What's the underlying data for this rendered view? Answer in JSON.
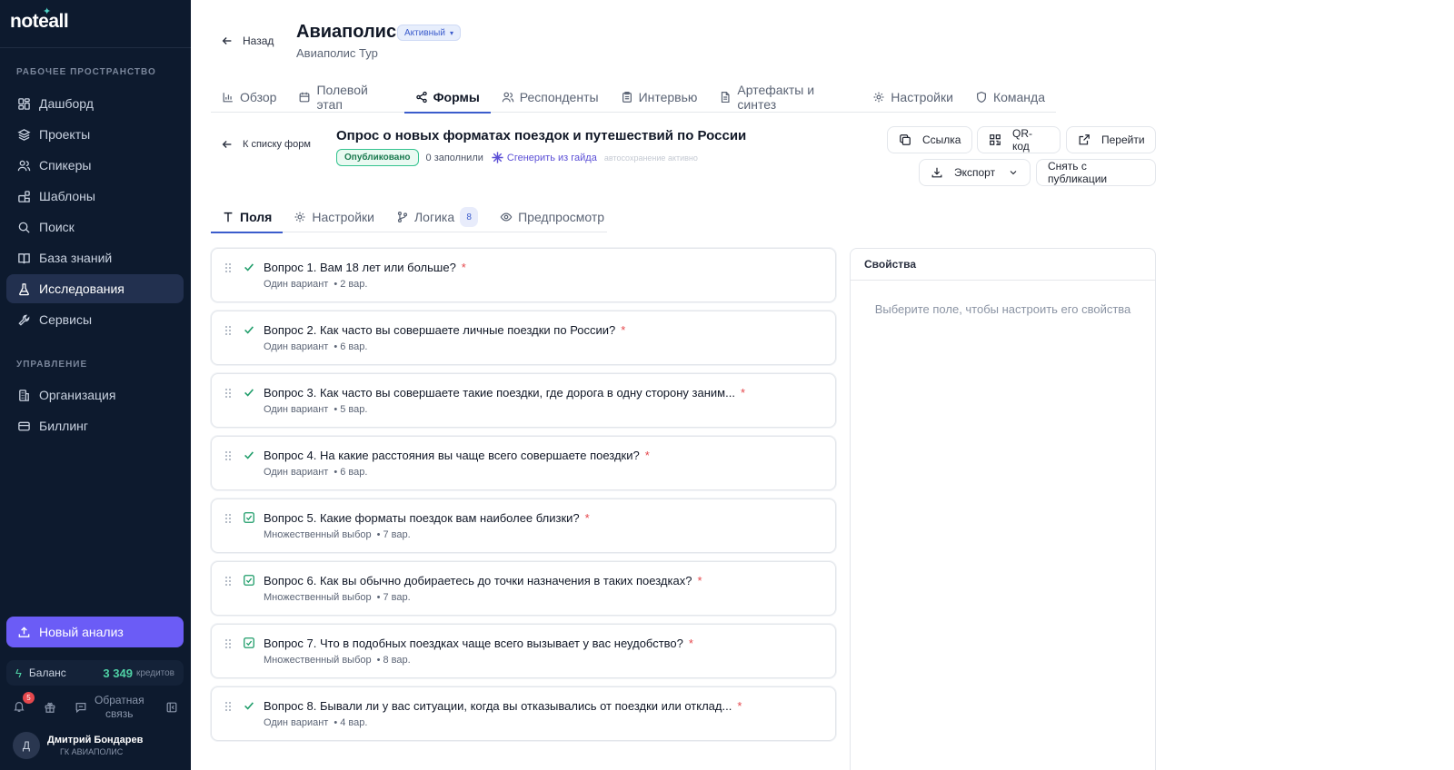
{
  "sidebar": {
    "logo": "noteall",
    "section_workspace": "РАБОЧЕЕ ПРОСТРАНСТВО",
    "workspace_items": [
      {
        "label": "Дашборд",
        "icon": "dashboard-icon"
      },
      {
        "label": "Проекты",
        "icon": "layers-icon"
      },
      {
        "label": "Спикеры",
        "icon": "users-icon"
      },
      {
        "label": "Шаблоны",
        "icon": "templates-icon"
      },
      {
        "label": "Поиск",
        "icon": "search-icon"
      },
      {
        "label": "База знаний",
        "icon": "book-icon"
      },
      {
        "label": "Исследования",
        "icon": "flask-icon",
        "active": true
      },
      {
        "label": "Сервисы",
        "icon": "wrench-icon"
      }
    ],
    "section_manage": "УПРАВЛЕНИЕ",
    "manage_items": [
      {
        "label": "Организация",
        "icon": "building-icon"
      },
      {
        "label": "Биллинг",
        "icon": "card-icon"
      }
    ],
    "new_analysis": "Новый анализ",
    "balance_label": "Баланс",
    "balance_value": "3 349",
    "balance_unit": "кредитов",
    "notifications_count": "5",
    "feedback_line1": "Обратная",
    "feedback_line2": "связь",
    "user_initial": "Д",
    "user_name": "Дмитрий Бондарев",
    "user_org": "ГК АВИАПОЛИС"
  },
  "header": {
    "back_label": "Назад",
    "project_title": "Авиаполис",
    "status": "Активный",
    "project_subtitle": "Авиаполис Тур"
  },
  "tabs": [
    {
      "label": "Обзор",
      "icon": "bar-chart-icon"
    },
    {
      "label": "Полевой этап",
      "icon": "calendar-icon"
    },
    {
      "label": "Формы",
      "icon": "share-icon",
      "active": true
    },
    {
      "label": "Респонденты",
      "icon": "users-icon"
    },
    {
      "label": "Интервью",
      "icon": "clipboard-icon"
    },
    {
      "label": "Артефакты и синтез",
      "icon": "file-icon"
    },
    {
      "label": "Настройки",
      "icon": "gear-icon"
    },
    {
      "label": "Команда",
      "icon": "shield-icon"
    }
  ],
  "form": {
    "back_label": "К списку форм",
    "title": "Опрос о новых форматах поездок и путешествий по России",
    "published": "Опубликовано",
    "filled": "0 заполнили",
    "generate": "Сгенерить из гайда",
    "autosave": "автосохранение активно"
  },
  "actions": {
    "link": "Ссылка",
    "qr": "QR-код",
    "open": "Перейти",
    "export": "Экспорт",
    "unpublish": "Снять с публикации"
  },
  "subtabs": [
    {
      "label": "Поля",
      "icon": "text-icon",
      "active": true
    },
    {
      "label": "Настройки",
      "icon": "gear-icon"
    },
    {
      "label": "Логика",
      "icon": "branch-icon",
      "badge": "8"
    },
    {
      "label": "Предпросмотр",
      "icon": "eye-icon"
    }
  ],
  "questions": [
    {
      "title": "Вопрос 1. Вам 18 лет или больше?",
      "type": "Один вариант",
      "count": "2 вар.",
      "kind": "single"
    },
    {
      "title": "Вопрос 2. Как часто вы совершаете личные поездки по России?",
      "type": "Один вариант",
      "count": "6 вар.",
      "kind": "single"
    },
    {
      "title": "Вопрос 3. Как часто вы совершаете такие поездки, где дорога в одну сторону заним...",
      "type": "Один вариант",
      "count": "5 вар.",
      "kind": "single"
    },
    {
      "title": "Вопрос 4. На какие расстояния вы чаще всего совершаете поездки?",
      "type": "Один вариант",
      "count": "6 вар.",
      "kind": "single"
    },
    {
      "title": "Вопрос 5. Какие форматы поездок вам наиболее близки?",
      "type": "Множественный выбор",
      "count": "7 вар.",
      "kind": "multi"
    },
    {
      "title": "Вопрос 6. Как вы обычно добираетесь до точки назначения в таких поездках?",
      "type": "Множественный выбор",
      "count": "7 вар.",
      "kind": "multi"
    },
    {
      "title": "Вопрос 7. Что в подобных поездках чаще всего вызывает у вас неудобство?",
      "type": "Множественный выбор",
      "count": "8 вар.",
      "kind": "multi"
    },
    {
      "title": "Вопрос 8. Бывали ли у вас ситуации, когда вы отказывались от поездки или отклад...",
      "type": "Один вариант",
      "count": "4 вар.",
      "kind": "single"
    }
  ],
  "required_mark": "*",
  "properties": {
    "title": "Свойства",
    "empty": "Выберите поле, чтобы настроить его свойства"
  }
}
